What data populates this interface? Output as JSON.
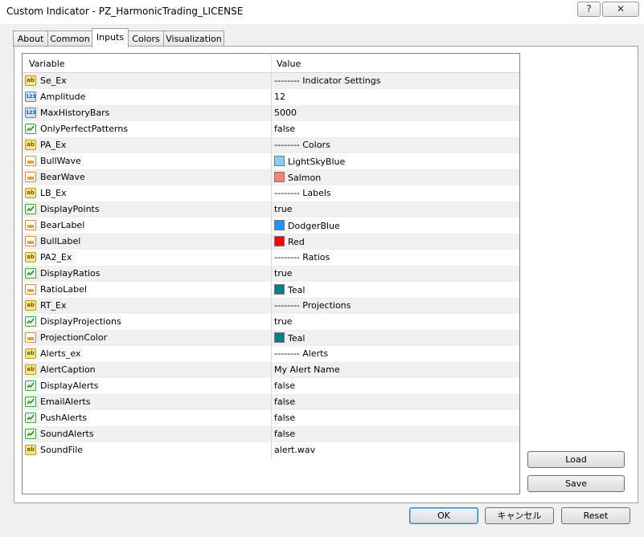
{
  "window": {
    "title": "Custom Indicator - PZ_HarmonicTrading_LICENSE",
    "help_label": "?",
    "close_label": "✕"
  },
  "tabs": [
    {
      "label": "About"
    },
    {
      "label": "Common"
    },
    {
      "label": "Inputs",
      "active": true
    },
    {
      "label": "Colors"
    },
    {
      "label": "Visualization"
    }
  ],
  "grid": {
    "col_variable": "Variable",
    "col_value": "Value",
    "rows": [
      {
        "type": "ab",
        "variable": "Se_Ex",
        "value": "-------- Indicator Settings"
      },
      {
        "type": "num",
        "variable": "Amplitude",
        "value": "12"
      },
      {
        "type": "num",
        "variable": "MaxHistoryBars",
        "value": "5000"
      },
      {
        "type": "bool",
        "variable": "OnlyPerfectPatterns",
        "value": "false"
      },
      {
        "type": "ab",
        "variable": "PA_Ex",
        "value": "-------- Colors"
      },
      {
        "type": "color",
        "variable": "BullWave",
        "value": "LightSkyBlue",
        "swatch": "#87cefa"
      },
      {
        "type": "color",
        "variable": "BearWave",
        "value": "Salmon",
        "swatch": "#fa8072"
      },
      {
        "type": "ab",
        "variable": "LB_Ex",
        "value": "-------- Labels"
      },
      {
        "type": "bool",
        "variable": "DisplayPoints",
        "value": "true"
      },
      {
        "type": "color",
        "variable": "BearLabel",
        "value": "DodgerBlue",
        "swatch": "#1e90ff"
      },
      {
        "type": "color",
        "variable": "BullLabel",
        "value": "Red",
        "swatch": "#ff0000"
      },
      {
        "type": "ab",
        "variable": "PA2_Ex",
        "value": "-------- Ratios"
      },
      {
        "type": "bool",
        "variable": "DisplayRatios",
        "value": "true"
      },
      {
        "type": "color",
        "variable": "RatioLabel",
        "value": "Teal",
        "swatch": "#008080"
      },
      {
        "type": "ab",
        "variable": "RT_Ex",
        "value": "-------- Projections"
      },
      {
        "type": "bool",
        "variable": "DisplayProjections",
        "value": "true"
      },
      {
        "type": "color",
        "variable": "ProjectionColor",
        "value": "Teal",
        "swatch": "#008080"
      },
      {
        "type": "ab",
        "variable": "Alerts_ex",
        "value": "-------- Alerts"
      },
      {
        "type": "ab",
        "variable": "AlertCaption",
        "value": "My Alert Name"
      },
      {
        "type": "bool",
        "variable": "DisplayAlerts",
        "value": "false"
      },
      {
        "type": "bool",
        "variable": "EmailAlerts",
        "value": "false"
      },
      {
        "type": "bool",
        "variable": "PushAlerts",
        "value": "false"
      },
      {
        "type": "bool",
        "variable": "SoundAlerts",
        "value": "false"
      },
      {
        "type": "ab",
        "variable": "SoundFile",
        "value": "alert.wav"
      }
    ]
  },
  "buttons": {
    "load": "Load",
    "save": "Save",
    "ok": "OK",
    "cancel": "キャンセル",
    "reset": "Reset"
  },
  "icons": {
    "ab": "string-type-icon",
    "num": "integer-type-icon",
    "bool": "boolean-type-icon",
    "color": "color-type-icon"
  }
}
